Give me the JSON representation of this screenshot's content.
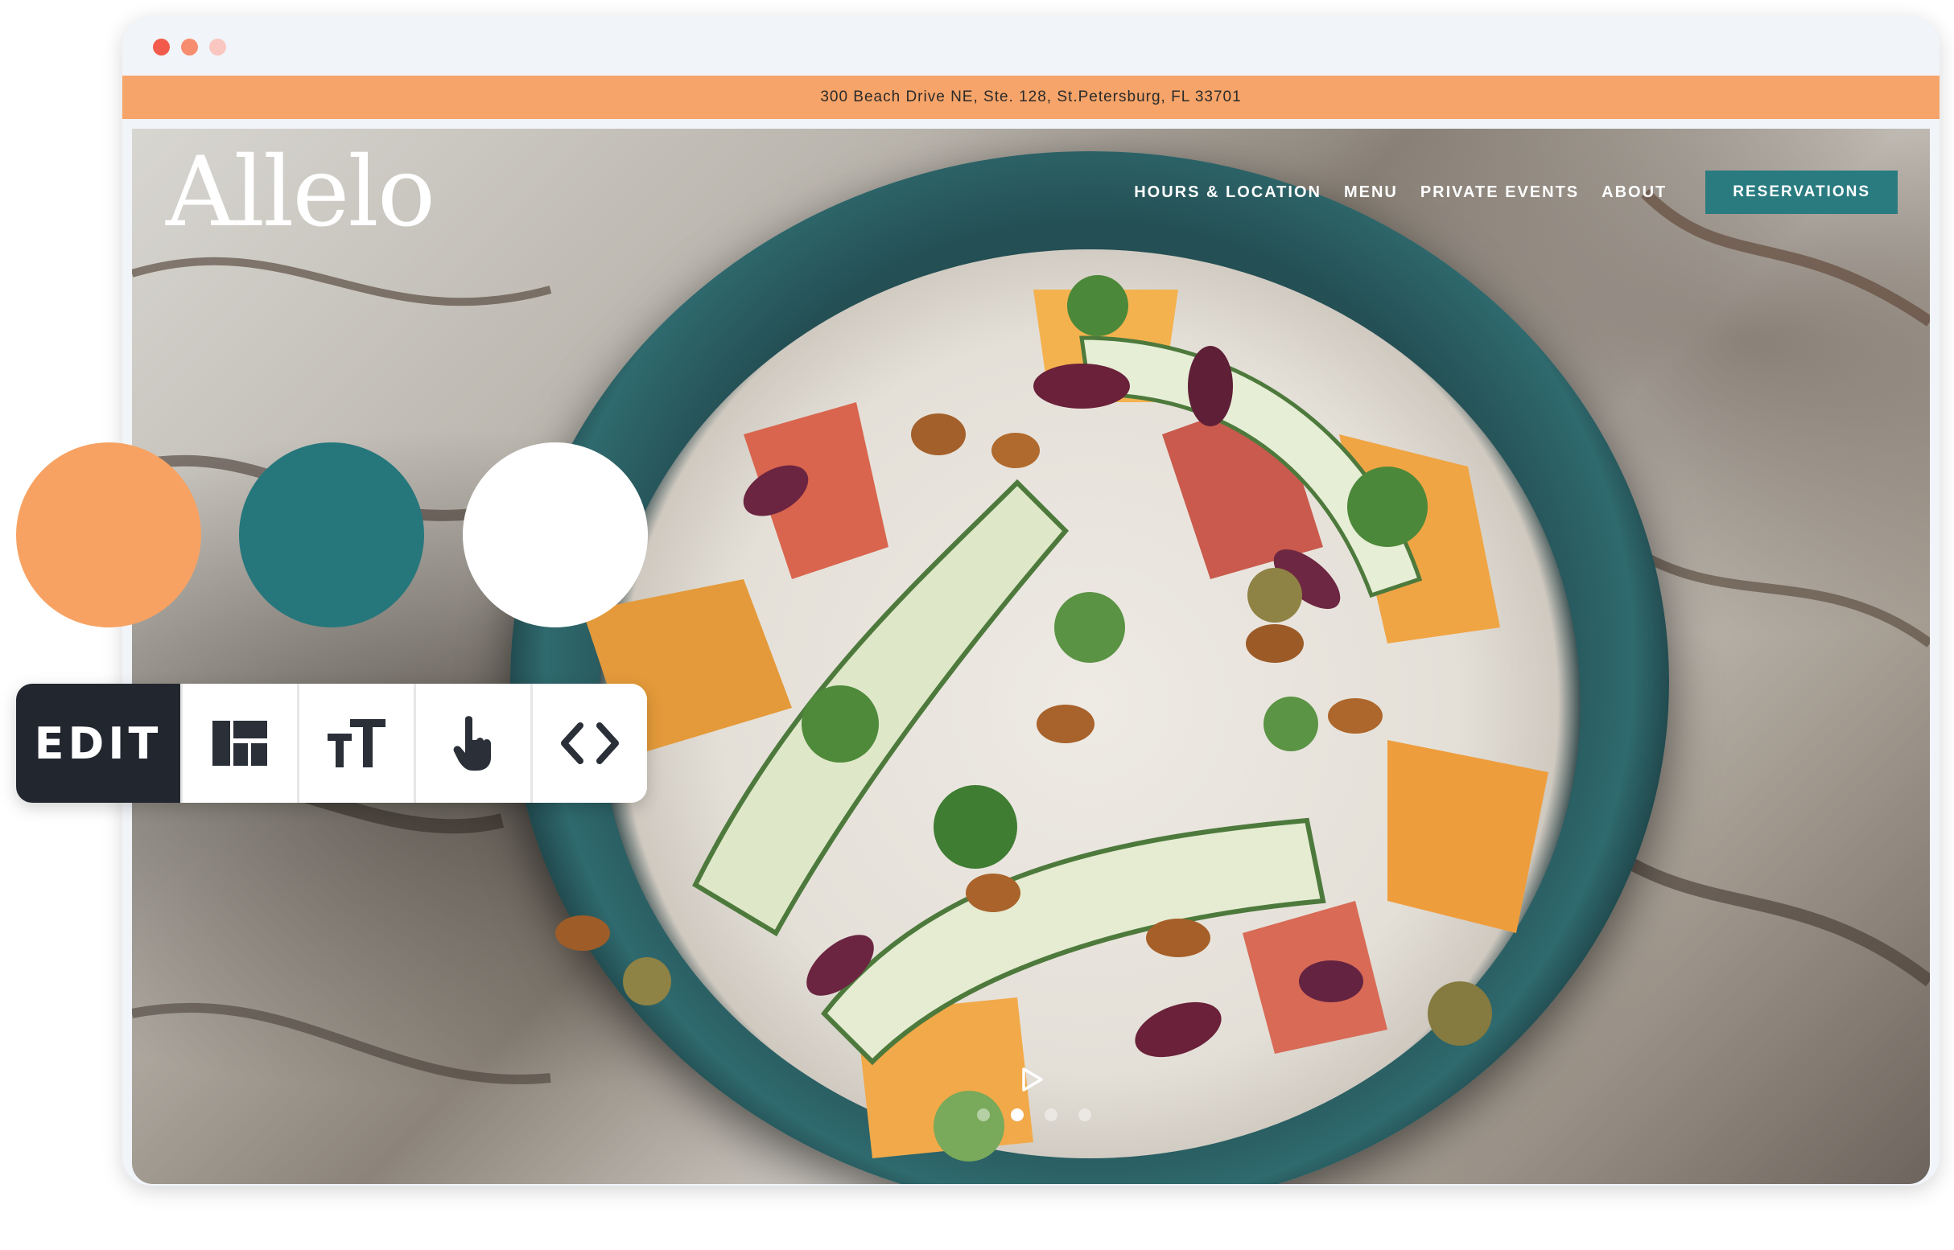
{
  "browser": {
    "window_dots": [
      "#f25b4b",
      "#f78d6f",
      "#f9c7c0"
    ]
  },
  "topbar": {
    "address": "300 Beach Drive NE, Ste. 128, St.Petersburg, FL 33701",
    "background": "#f6a469"
  },
  "site": {
    "logo": "Allelo",
    "nav": [
      {
        "label": "HOURS & LOCATION"
      },
      {
        "label": "MENU"
      },
      {
        "label": "PRIVATE EVENTS"
      },
      {
        "label": "ABOUT"
      }
    ],
    "cta_label": "RESERVATIONS",
    "accent": "#2a7b80"
  },
  "carousel": {
    "slides": 4,
    "active_index": 1,
    "play_icon": "play-icon"
  },
  "palette": {
    "swatches": [
      "#f7a263",
      "#26777c",
      "#ffffff"
    ]
  },
  "toolbar": {
    "edit_label": "EDIT",
    "tools": [
      "layout-icon",
      "text-size-icon",
      "pointer-hand-icon",
      "code-icon"
    ]
  }
}
